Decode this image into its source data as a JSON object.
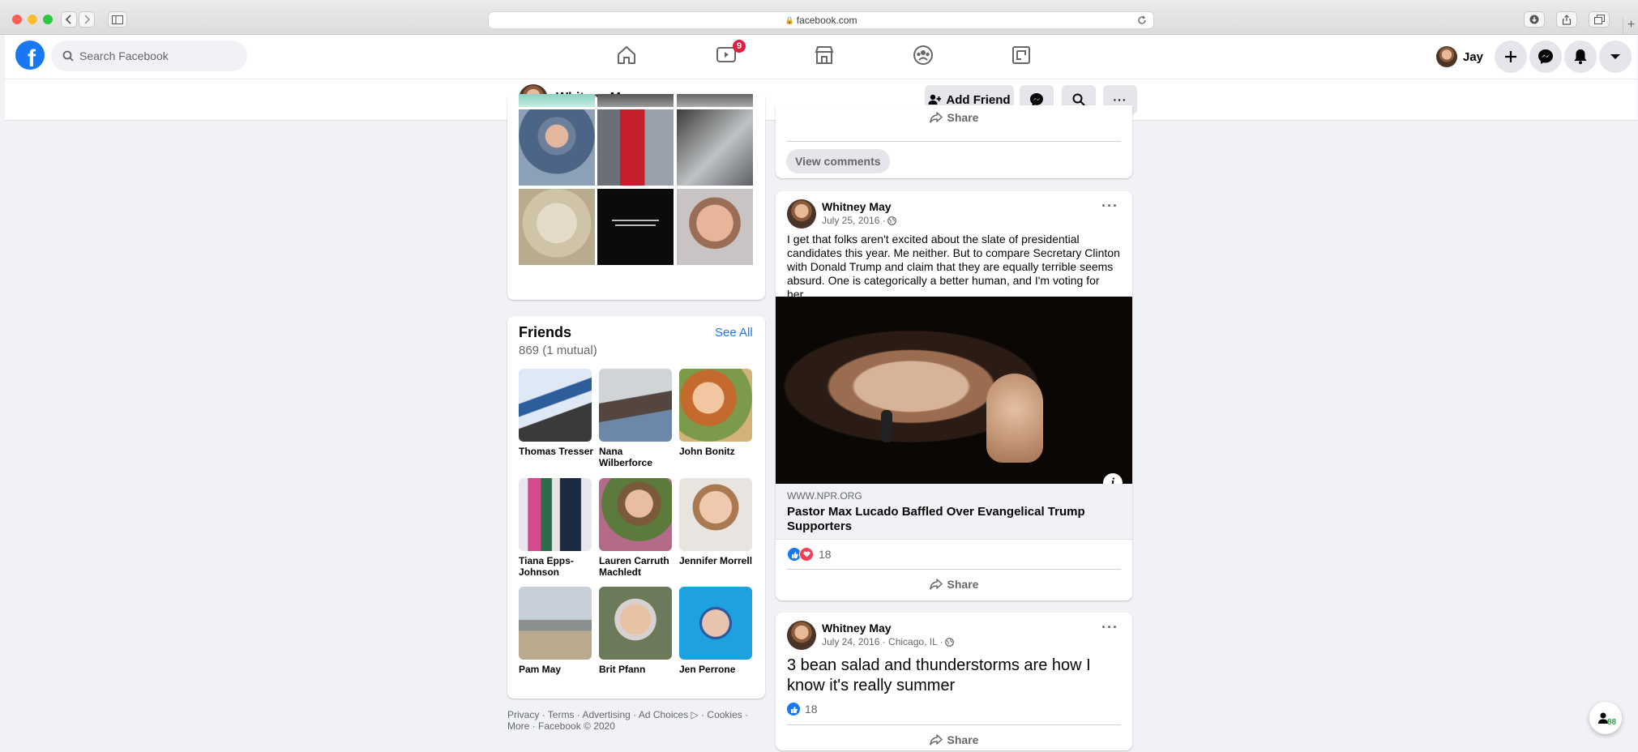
{
  "browser": {
    "url": "facebook.com"
  },
  "topnav": {
    "search_placeholder": "Search Facebook",
    "watch_badge": "9",
    "user_name": "Jay",
    "chat_badge": "88"
  },
  "profile_bar": {
    "name": "Whitney May",
    "add_friend_label": "Add Friend",
    "more_label": "···"
  },
  "left": {
    "friends_title": "Friends",
    "friends_count": "869 (1 mutual)",
    "see_all": "See All",
    "friends": [
      {
        "name": "Thomas Tresser"
      },
      {
        "name": "Nana Wilberforce"
      },
      {
        "name": "John Bonitz"
      },
      {
        "name": "Tiana Epps-Johnson"
      },
      {
        "name": "Lauren Carruth Machledt"
      },
      {
        "name": "Jennifer Morrell"
      },
      {
        "name": "Pam May"
      },
      {
        "name": "Brit Pfann"
      },
      {
        "name": "Jen Perrone"
      }
    ],
    "footer_line1": "Privacy · Terms · Advertising · Ad Choices ▷ · Cookies ·",
    "footer_line2": "More · Facebook © 2020"
  },
  "feed": {
    "prev_share": "Share",
    "view_comments": "View comments",
    "post1": {
      "author": "Whitney May",
      "date": "July 25, 2016 · ",
      "text": "I get that folks aren't excited about the slate of presidential candidates this year. Me neither. But to compare Secretary Clinton with Donald Trump and claim that they are equally terrible seems absurd. One is categorically a better human, and I'm voting for her.",
      "link_domain": "WWW.NPR.ORG",
      "link_title": "Pastor Max Lucado Baffled Over Evangelical Trump Supporters",
      "reactions": "18",
      "share": "Share"
    },
    "post2": {
      "author": "Whitney May",
      "date": "July 24, 2016 · Chicago, IL · ",
      "text": "3 bean salad and thunderstorms are how I know it's really summer",
      "reactions": "18",
      "share": "Share"
    }
  },
  "colors": {
    "fb_blue": "#1877f2",
    "badge_red": "#e41e3f",
    "background": "#f0f2f5"
  }
}
